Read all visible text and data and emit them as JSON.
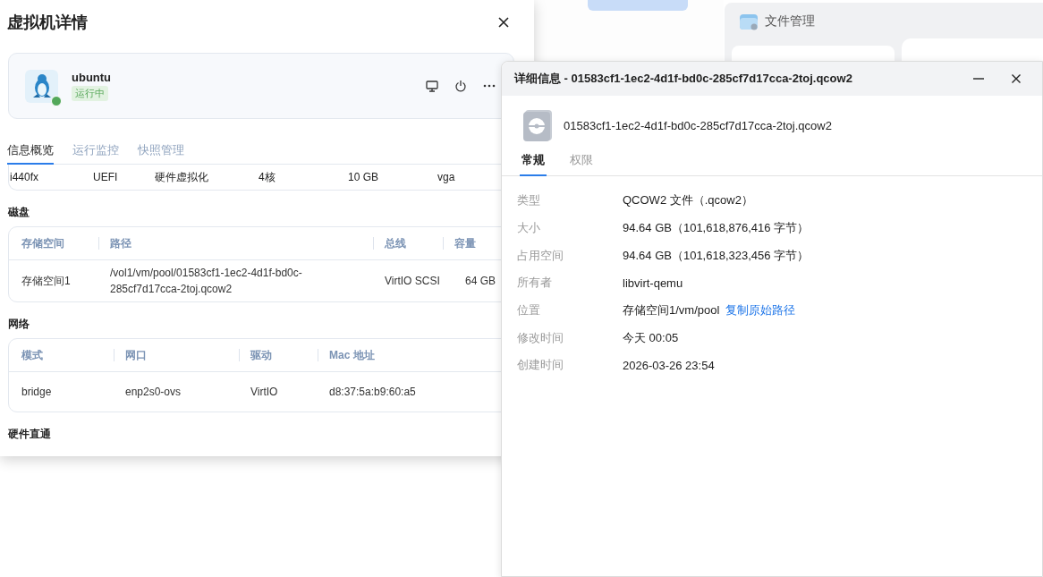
{
  "vm_dialog": {
    "title": "虚拟机详情",
    "vm": {
      "name": "ubuntu",
      "status": "运行中",
      "running": true
    },
    "tabs": [
      {
        "label": "信息概览",
        "selected": true
      },
      {
        "label": "运行监控",
        "selected": false
      },
      {
        "label": "快照管理",
        "selected": false
      }
    ],
    "overview_row": [
      "i440fx",
      "UEFI",
      "硬件虚拟化",
      "4核",
      "10 GB",
      "vga"
    ],
    "sections": [
      {
        "kind": "table",
        "title": "磁盘",
        "columns": [
          "存储空间",
          "路径",
          "总线",
          "容量"
        ],
        "rows": [
          [
            "存储空间1",
            "/vol1/vm/pool/01583cf1-1ec2-4d1f-bd0c-285cf7d17cca-2toj.qcow2",
            "VirtIO SCSI",
            "64 GB"
          ]
        ]
      },
      {
        "kind": "table",
        "title": "网络",
        "columns": [
          "模式",
          "网口",
          "驱动",
          "Mac 地址"
        ],
        "rows": [
          [
            "bridge",
            "enp2s0-ovs",
            "VirtIO",
            "d8:37:5a:b9:60:a5"
          ]
        ]
      },
      {
        "kind": "heading",
        "title": "硬件直通"
      }
    ]
  },
  "file_manager": {
    "title": "文件管理"
  },
  "details_window": {
    "title": "详细信息 - 01583cf1-1ec2-4d1f-bd0c-285cf7d17cca-2toj.qcow2",
    "file_name": "01583cf1-1ec2-4d1f-bd0c-285cf7d17cca-2toj.qcow2",
    "tabs": [
      {
        "label": "常规",
        "selected": true
      },
      {
        "label": "权限",
        "selected": false
      }
    ],
    "properties": [
      {
        "label": "类型",
        "value": "QCOW2 文件（.qcow2）"
      },
      {
        "label": "大小",
        "value": "94.64 GB（101,618,876,416 字节）"
      },
      {
        "label": "占用空间",
        "value": "94.64 GB（101,618,323,456 字节）"
      },
      {
        "label": "所有者",
        "value": "libvirt-qemu"
      },
      {
        "label": "位置",
        "value": "存储空间1/vm/pool",
        "link": "复制原始路径"
      },
      {
        "label": "修改时间",
        "value": "今天 00:05"
      },
      {
        "label": "创建时间",
        "value": "2026-03-26 23:54"
      }
    ]
  }
}
